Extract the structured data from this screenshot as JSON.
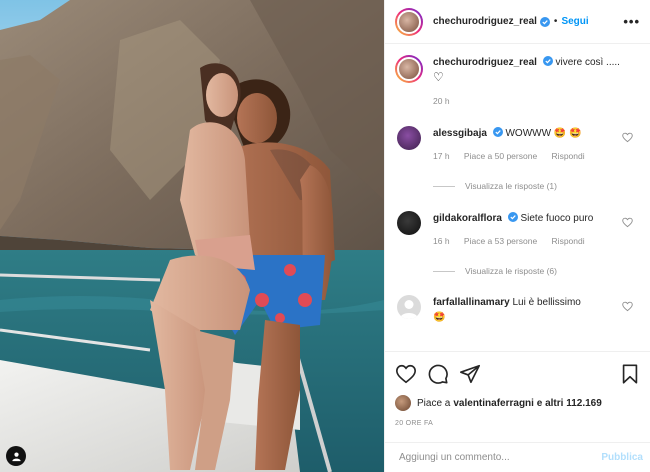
{
  "post": {
    "author": "chechurodriguez_real",
    "follow_label": "Segui",
    "more_label": "•••",
    "separator": "•"
  },
  "caption": {
    "author": "chechurodriguez_real",
    "text": "vivere così .....",
    "emoji": "♡",
    "time": "20 h"
  },
  "comments": [
    {
      "user": "alessgibaja",
      "text": "WOWWW 🤩 🤩",
      "time": "17 h",
      "likes": "Piace a 50 persone",
      "reply": "Rispondi",
      "view_replies": "Visualizza le risposte (1)",
      "verified": true
    },
    {
      "user": "gildakoralflora",
      "text": "Siete fuoco puro",
      "time": "16 h",
      "likes": "Piace a 53 persone",
      "reply": "Rispondi",
      "view_replies": "Visualizza le risposte (6)",
      "verified": true
    },
    {
      "user": "farfallallinamary",
      "text": "Lui è bellissimo",
      "text2": "🤩",
      "verified": false
    }
  ],
  "likes_line": {
    "prefix": "Piace a ",
    "user": "valentinaferragni",
    "suffix": " e altri 112.169"
  },
  "post_time": "20 ORE FA",
  "add_comment": {
    "placeholder": "Aggiungi un commento...",
    "publish_label": "Pubblica"
  },
  "colors": {
    "accent": "#0095f6",
    "verified": "#3897f0",
    "muted": "#8e8e8e",
    "publish_disabled": "#b2dffc"
  }
}
